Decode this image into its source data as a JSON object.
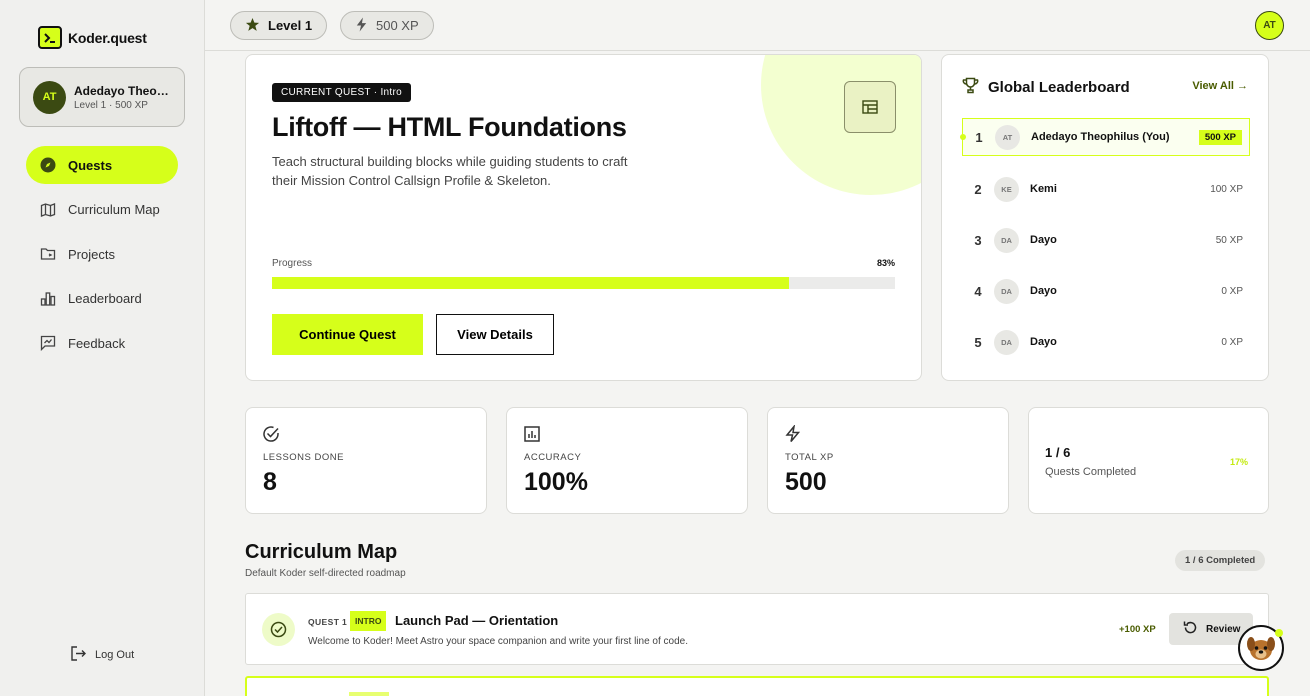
{
  "brand": {
    "name": "Koder.quest"
  },
  "profile": {
    "initials": "AT",
    "name": "Adedayo Theophilus",
    "subtitle": "Level 1 · 500 XP"
  },
  "nav": [
    {
      "label": "Quests",
      "icon": "compass-icon",
      "active": true
    },
    {
      "label": "Curriculum Map",
      "icon": "map-icon"
    },
    {
      "label": "Projects",
      "icon": "folder-icon"
    },
    {
      "label": "Leaderboard",
      "icon": "bar-chart-icon"
    },
    {
      "label": "Feedback",
      "icon": "feedback-icon"
    }
  ],
  "logout_label": "Log Out",
  "topbar": {
    "level_label": "Level 1",
    "xp_label": "500 XP",
    "avatar_initials": "AT"
  },
  "quest": {
    "badge": "CURRENT QUEST · Intro",
    "title": "Liftoff — HTML Foundations",
    "description": "Teach structural building blocks while guiding students to craft their Mission Control Callsign Profile & Skeleton.",
    "progress_label": "Progress",
    "progress_text": "83%",
    "progress_value": 83,
    "continue_label": "Continue Quest",
    "details_label": "View Details"
  },
  "leaderboard": {
    "title": "Global Leaderboard",
    "view_all": "View All →",
    "rows": [
      {
        "rank": "1",
        "initials": "AT",
        "name": "Adedayo Theophilus (You)",
        "xp": "500 XP",
        "me": true
      },
      {
        "rank": "2",
        "initials": "KE",
        "name": "Kemi",
        "xp": "100 XP"
      },
      {
        "rank": "3",
        "initials": "DA",
        "name": "Dayo",
        "xp": "50 XP"
      },
      {
        "rank": "4",
        "initials": "DA",
        "name": "Dayo",
        "xp": "0 XP"
      },
      {
        "rank": "5",
        "initials": "DA",
        "name": "Dayo",
        "xp": "0 XP"
      }
    ]
  },
  "stats": [
    {
      "label": "LESSONS DONE",
      "value": "8",
      "icon": "check-circle-icon"
    },
    {
      "label": "ACCURACY",
      "value": "100%",
      "icon": "chart-box-icon"
    },
    {
      "label": "TOTAL XP",
      "value": "500",
      "icon": "lightning-icon"
    }
  ],
  "quests_completed": {
    "value": "1 / 6",
    "label": "Quests Completed",
    "percent": "17%"
  },
  "curriculum": {
    "title": "Curriculum Map",
    "subtitle": "Default Koder self-directed roadmap",
    "badge": "1 / 6 Completed",
    "items": [
      {
        "number": "QUEST 1",
        "tag": "INTRO",
        "name": "Launch Pad — Orientation",
        "description": "Welcome to Koder! Meet Astro your space companion and write your first line of code.",
        "xp": "+100 XP",
        "action": "Review"
      }
    ]
  },
  "colors": {
    "accent": "#d6ff1a",
    "dark_olive": "#3b4a12"
  }
}
